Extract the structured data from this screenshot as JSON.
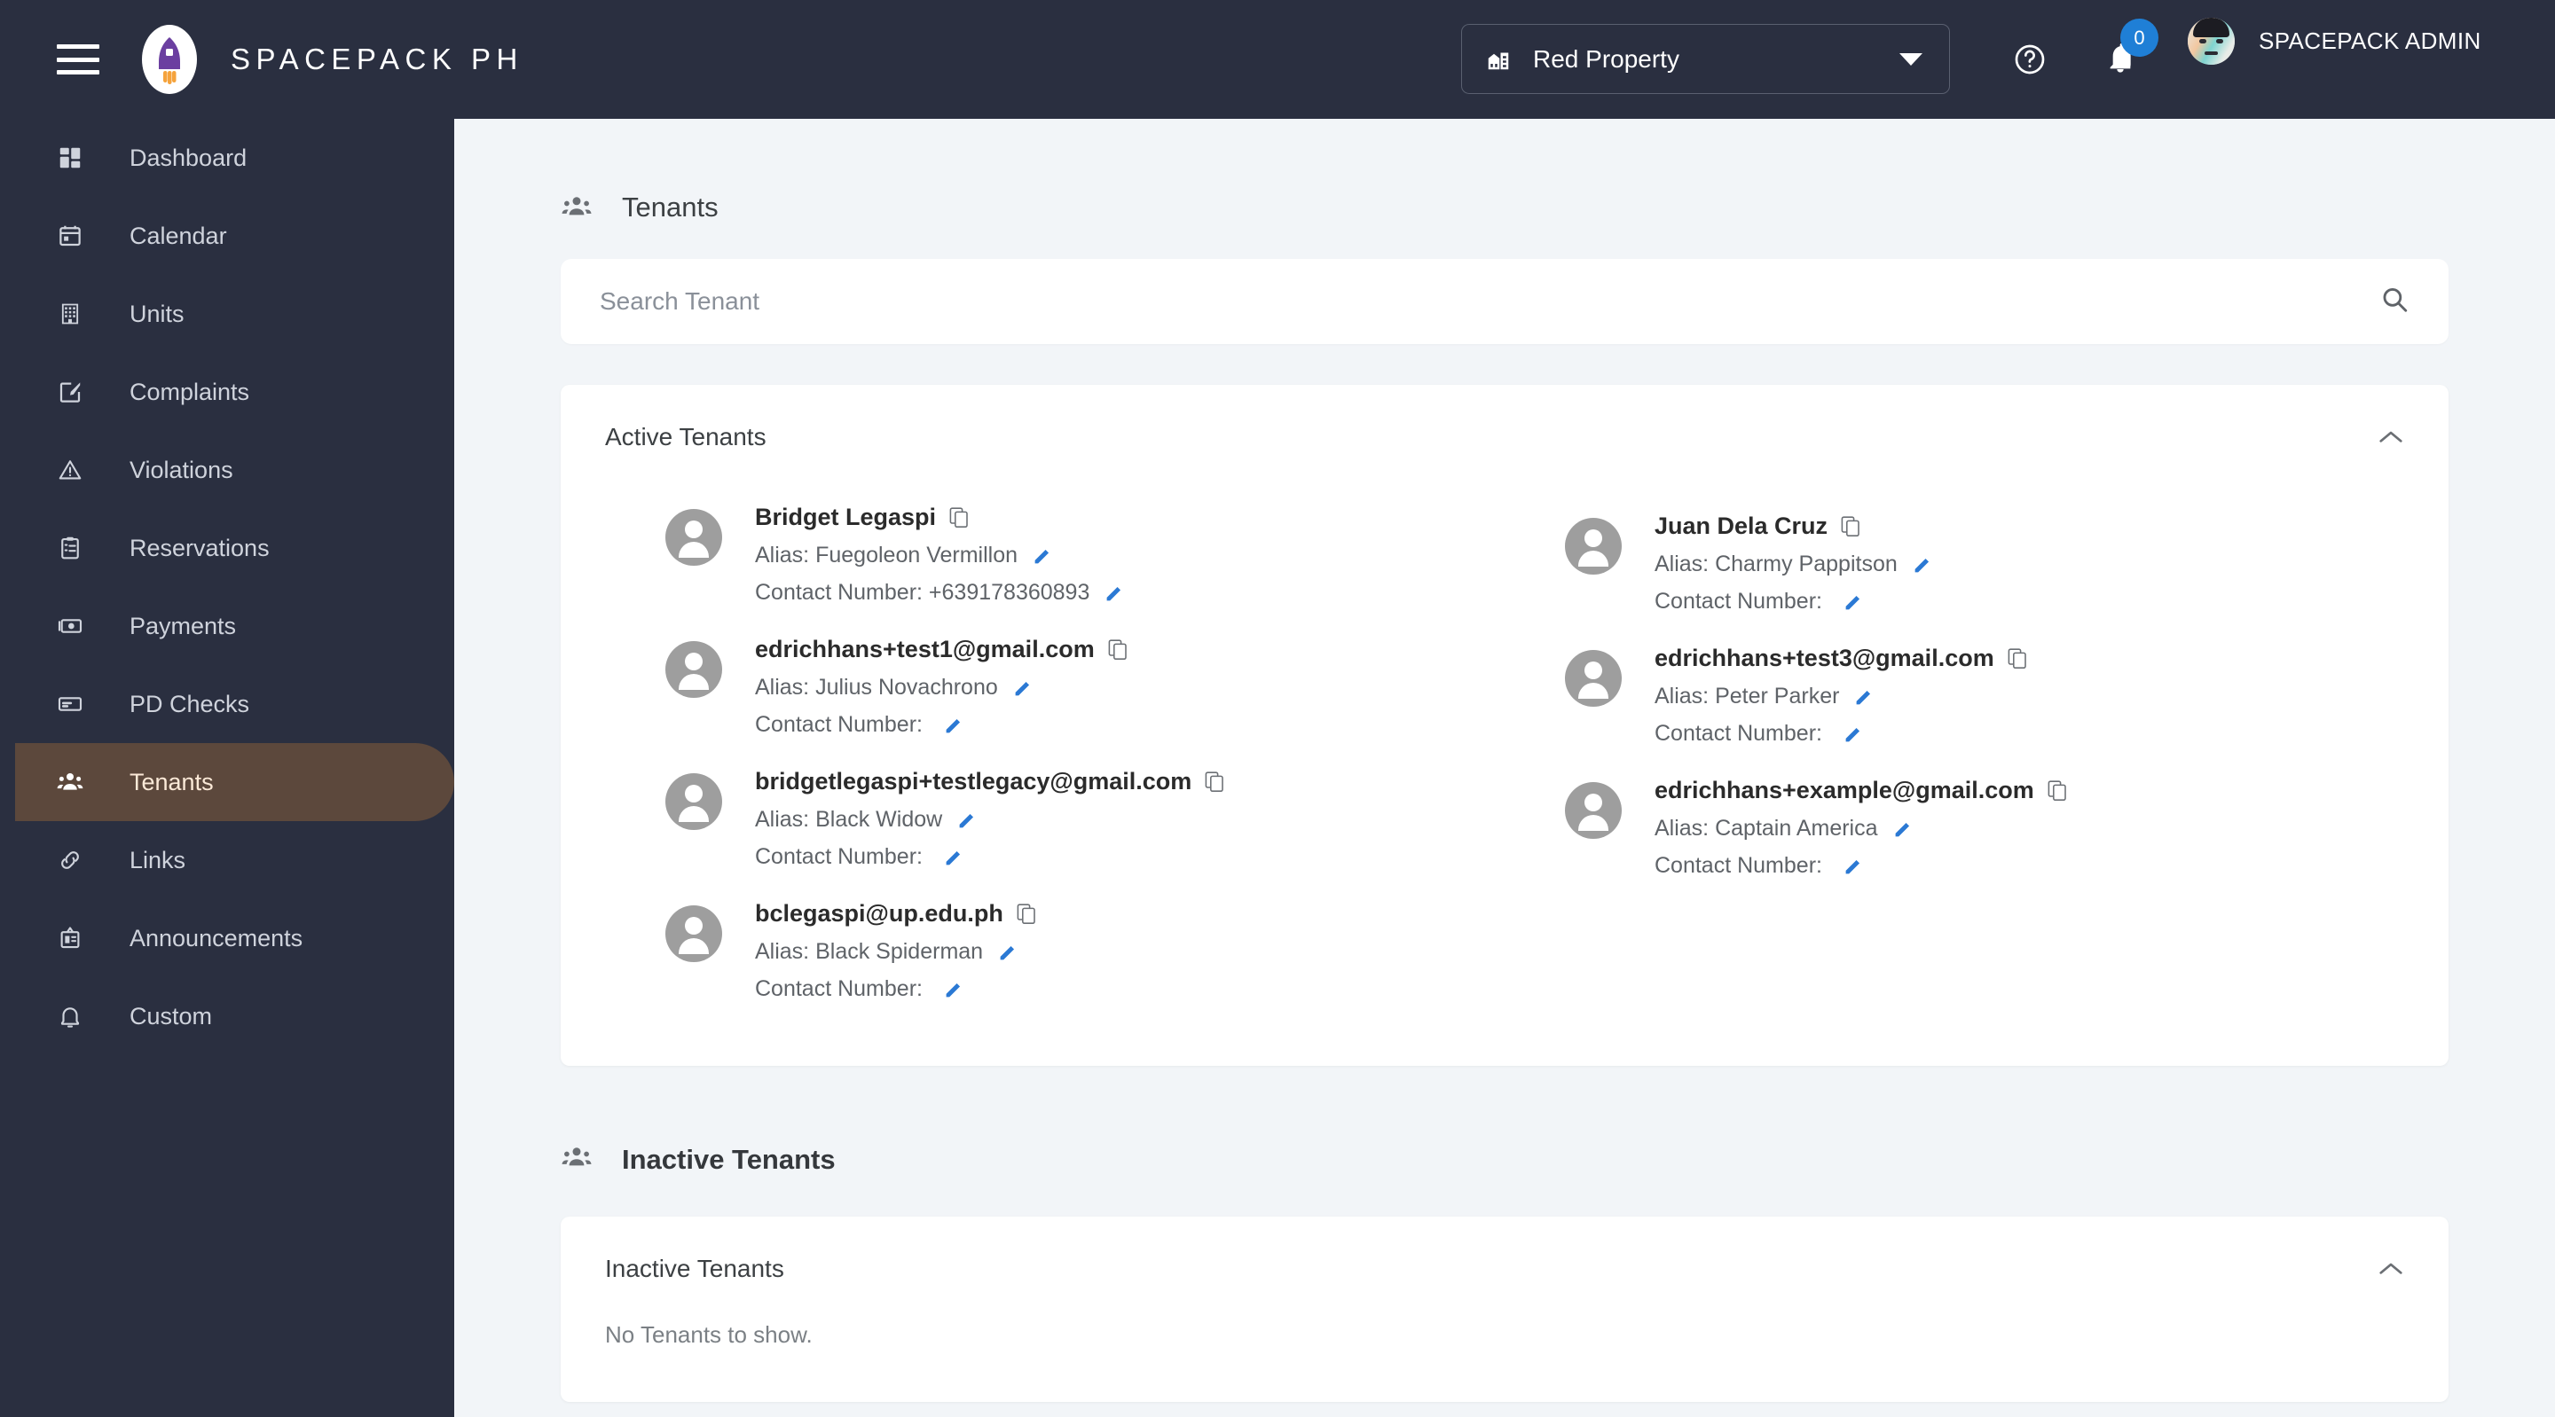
{
  "topbar": {
    "menu_icon": "hamburger-icon",
    "logo_icon": "rocket-logo-icon",
    "brand": "SPACEPACK PH",
    "property_selector": {
      "icon": "building-icon",
      "value": "Red Property",
      "caret": "chevron-down-icon"
    },
    "help_icon": "help-circle-icon",
    "notifications": {
      "icon": "bell-icon",
      "count": "0",
      "badge_color": "#1f7fd6"
    },
    "user": {
      "avatar": "user-avatar",
      "name": "SPACEPACK ADMIN"
    }
  },
  "sidebar": {
    "active_bg": "#5c483c",
    "bg": "#2a2f40",
    "items": [
      {
        "label": "Dashboard",
        "icon": "dashboard-icon",
        "active": false
      },
      {
        "label": "Calendar",
        "icon": "calendar-icon",
        "active": false
      },
      {
        "label": "Units",
        "icon": "building-grid-icon",
        "active": false
      },
      {
        "label": "Complaints",
        "icon": "note-edit-icon",
        "active": false
      },
      {
        "label": "Violations",
        "icon": "warning-triangle-icon",
        "active": false
      },
      {
        "label": "Reservations",
        "icon": "clipboard-list-icon",
        "active": false
      },
      {
        "label": "Payments",
        "icon": "money-icon",
        "active": false
      },
      {
        "label": "PD Checks",
        "icon": "check-card-icon",
        "active": false
      },
      {
        "label": "Tenants",
        "icon": "people-icon",
        "active": true
      },
      {
        "label": "Links",
        "icon": "link-icon",
        "active": false
      },
      {
        "label": "Announcements",
        "icon": "announcement-icon",
        "active": false
      },
      {
        "label": "Custom",
        "icon": "bell-outline-icon",
        "active": false
      }
    ]
  },
  "main": {
    "page_title": "Tenants",
    "page_title_icon": "people-icon",
    "search": {
      "placeholder": "Search Tenant",
      "value": "",
      "icon": "search-icon"
    },
    "active_card": {
      "title": "Active Tenants",
      "collapse_icon": "chevron-up-icon",
      "left_column": [
        {
          "name": "Bridget Legaspi",
          "copy_icon": "copy-icon",
          "alias_label": "Alias:",
          "alias": "Fuegoleon Vermillon",
          "contact_label": "Contact Number:",
          "contact": "+639178360893",
          "edit_icon": "pencil-icon"
        },
        {
          "name": "edrichhans+test1@gmail.com",
          "copy_icon": "copy-icon",
          "alias_label": "Alias:",
          "alias": "Julius Novachrono",
          "contact_label": "Contact Number:",
          "contact": "",
          "edit_icon": "pencil-icon"
        },
        {
          "name": "bridgetlegaspi+testlegacy@gmail.com",
          "copy_icon": "copy-icon",
          "alias_label": "Alias:",
          "alias": "Black Widow",
          "contact_label": "Contact Number:",
          "contact": "",
          "edit_icon": "pencil-icon"
        },
        {
          "name": "bclegaspi@up.edu.ph",
          "copy_icon": "copy-icon",
          "alias_label": "Alias:",
          "alias": "Black Spiderman",
          "contact_label": "Contact Number:",
          "contact": "",
          "edit_icon": "pencil-icon"
        }
      ],
      "right_column": [
        {
          "name": "Juan Dela Cruz",
          "copy_icon": "copy-icon",
          "alias_label": "Alias:",
          "alias": "Charmy Pappitson",
          "contact_label": "Contact Number:",
          "contact": "",
          "edit_icon": "pencil-icon"
        },
        {
          "name": "edrichhans+test3@gmail.com",
          "copy_icon": "copy-icon",
          "alias_label": "Alias:",
          "alias": "Peter Parker",
          "contact_label": "Contact Number:",
          "contact": "",
          "edit_icon": "pencil-icon"
        },
        {
          "name": "edrichhans+example@gmail.com",
          "copy_icon": "copy-icon",
          "alias_label": "Alias:",
          "alias": "Captain America",
          "contact_label": "Contact Number:",
          "contact": "",
          "edit_icon": "pencil-icon"
        }
      ]
    },
    "inactive_section": {
      "heading": "Inactive Tenants",
      "heading_icon": "people-icon",
      "card_title": "Inactive Tenants",
      "collapse_icon": "chevron-up-icon",
      "empty_text": "No Tenants to show."
    }
  },
  "colors": {
    "sidebar_bg": "#2a2f40",
    "content_bg": "#f2f5f8",
    "card_bg": "#ffffff",
    "accent_blue": "#1f7fd6",
    "edit_blue": "#2b79d4",
    "active_nav": "#5c483c",
    "logo_purple": "#6b3fa0",
    "logo_orange": "#f5a33c"
  }
}
